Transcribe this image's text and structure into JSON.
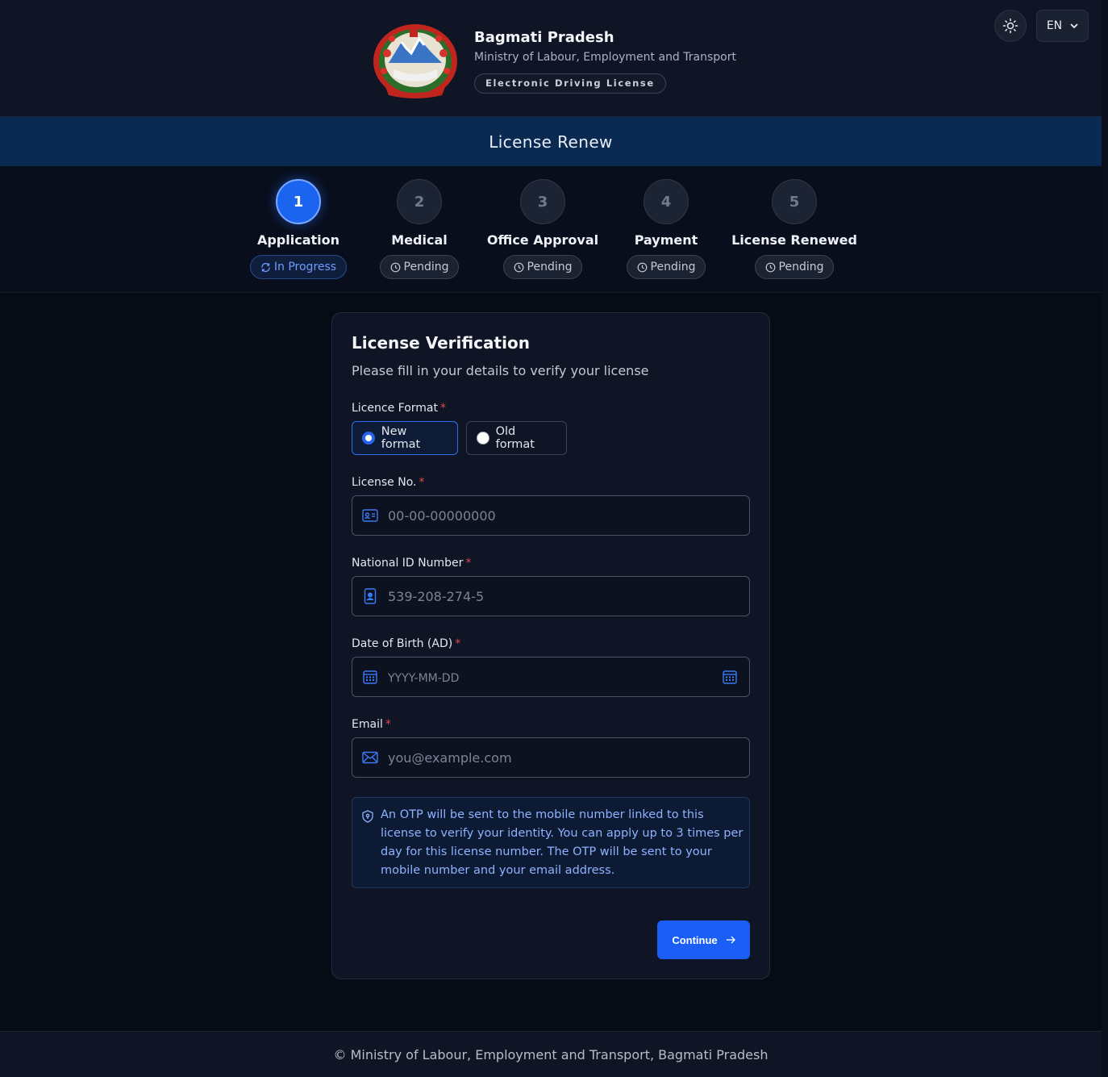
{
  "header": {
    "title": "Bagmati Pradesh",
    "subtitle": "Ministry of Labour, Employment and Transport",
    "pill": "Electronic Driving License",
    "language": "EN",
    "emblem_icon": "nepal-emblem"
  },
  "banner": {
    "title": "License Renew"
  },
  "stepper": {
    "steps": [
      {
        "number": "1",
        "label": "Application",
        "status": "In Progress",
        "active": true
      },
      {
        "number": "2",
        "label": "Medical",
        "status": "Pending",
        "active": false
      },
      {
        "number": "3",
        "label": "Office Approval",
        "status": "Pending",
        "active": false
      },
      {
        "number": "4",
        "label": "Payment",
        "status": "Pending",
        "active": false
      },
      {
        "number": "5",
        "label": "License Renewed",
        "status": "Pending",
        "active": false
      }
    ]
  },
  "form": {
    "title": "License Verification",
    "subtitle": "Please fill in your details to verify your license",
    "format_label": "Licence Format",
    "format_options": [
      "New format",
      "Old format"
    ],
    "format_selected": "New format",
    "license_label": "License No.",
    "license_placeholder": "00-00-00000000",
    "nid_label": "National ID Number",
    "nid_placeholder": "539-208-274-5",
    "dob_label": "Date of Birth (AD)",
    "dob_placeholder": "YYYY-MM-DD",
    "email_label": "Email",
    "email_placeholder": "you@example.com",
    "required_mark": "*",
    "note": "An OTP will be sent to the mobile number linked to this license to verify your identity. You can apply up to 3 times per day for this license number. The OTP will be sent to your mobile number and your email address.",
    "continue_label": "Continue"
  },
  "footer": {
    "text": "© Ministry of Labour, Employment and Transport, Bagmati Pradesh"
  },
  "colors": {
    "accent": "#1a5ef5",
    "banner": "#0a2a52",
    "background": "#060b16",
    "required": "#e5484d"
  }
}
